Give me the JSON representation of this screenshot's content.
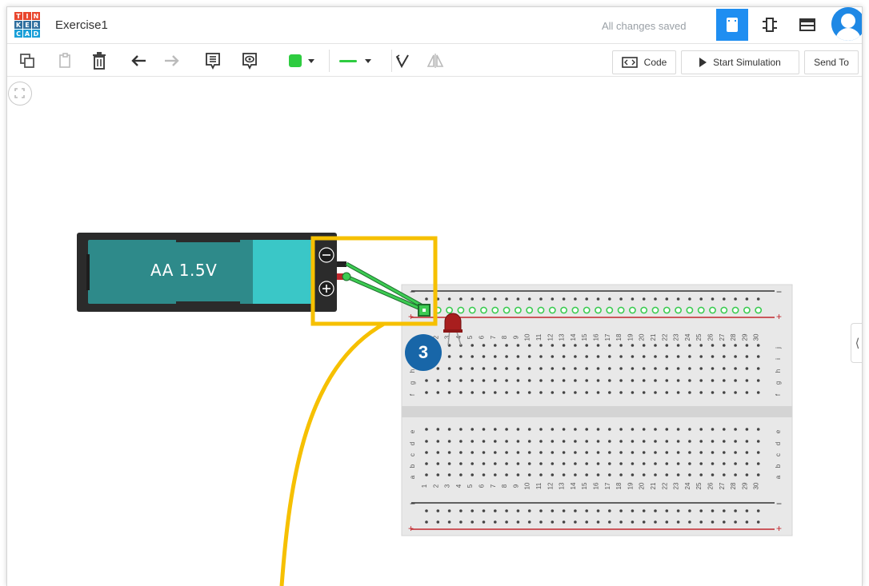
{
  "app": {
    "logo_letters": [
      "T",
      "I",
      "N",
      "K",
      "E",
      "R",
      "C",
      "A",
      "D"
    ],
    "logo_colors": [
      "#e8462e",
      "#e8462e",
      "#e8462e",
      "#2f6f9f",
      "#2f6f9f",
      "#2f6f9f",
      "#1a9fd8",
      "#1a9fd8",
      "#1a9fd8"
    ],
    "title": "Exercise1",
    "save_status": "All changes saved",
    "view_buttons": [
      {
        "name": "circuit-view",
        "active": true
      },
      {
        "name": "schematic-view",
        "active": false
      },
      {
        "name": "component-list-view",
        "active": false
      }
    ]
  },
  "toolbar": {
    "tools": [
      "copy-icon",
      "paste-icon",
      "delete-icon",
      "undo-icon",
      "redo-icon",
      "notes-icon",
      "notes-visibility-icon",
      "color-swatch",
      "wire-type",
      "rotate-icon",
      "flip-icon"
    ],
    "wire_color": "#2ecc40",
    "code_label": "Code",
    "simulate_label": "Start Simulation",
    "send_label": "Send To"
  },
  "battery": {
    "label": "AA 1.5V",
    "minus_symbol": "−",
    "plus_symbol": "+"
  },
  "breadboard": {
    "row_letters_top": [
      "j",
      "i",
      "h",
      "g",
      "f"
    ],
    "row_letters_bottom": [
      "e",
      "d",
      "c",
      "b",
      "a"
    ],
    "columns": [
      "1",
      "2",
      "3",
      "4",
      "5",
      "6",
      "7",
      "8",
      "9",
      "10",
      "11",
      "12",
      "13",
      "14",
      "15",
      "16",
      "17",
      "18",
      "19",
      "20",
      "21",
      "22",
      "23",
      "24",
      "25",
      "26",
      "27",
      "28",
      "29",
      "30"
    ],
    "rail_minus": "−",
    "rail_plus": "+"
  },
  "callout": {
    "number": "3",
    "highlight_color": "#f6c000"
  },
  "side_panel_toggle": "⟨"
}
